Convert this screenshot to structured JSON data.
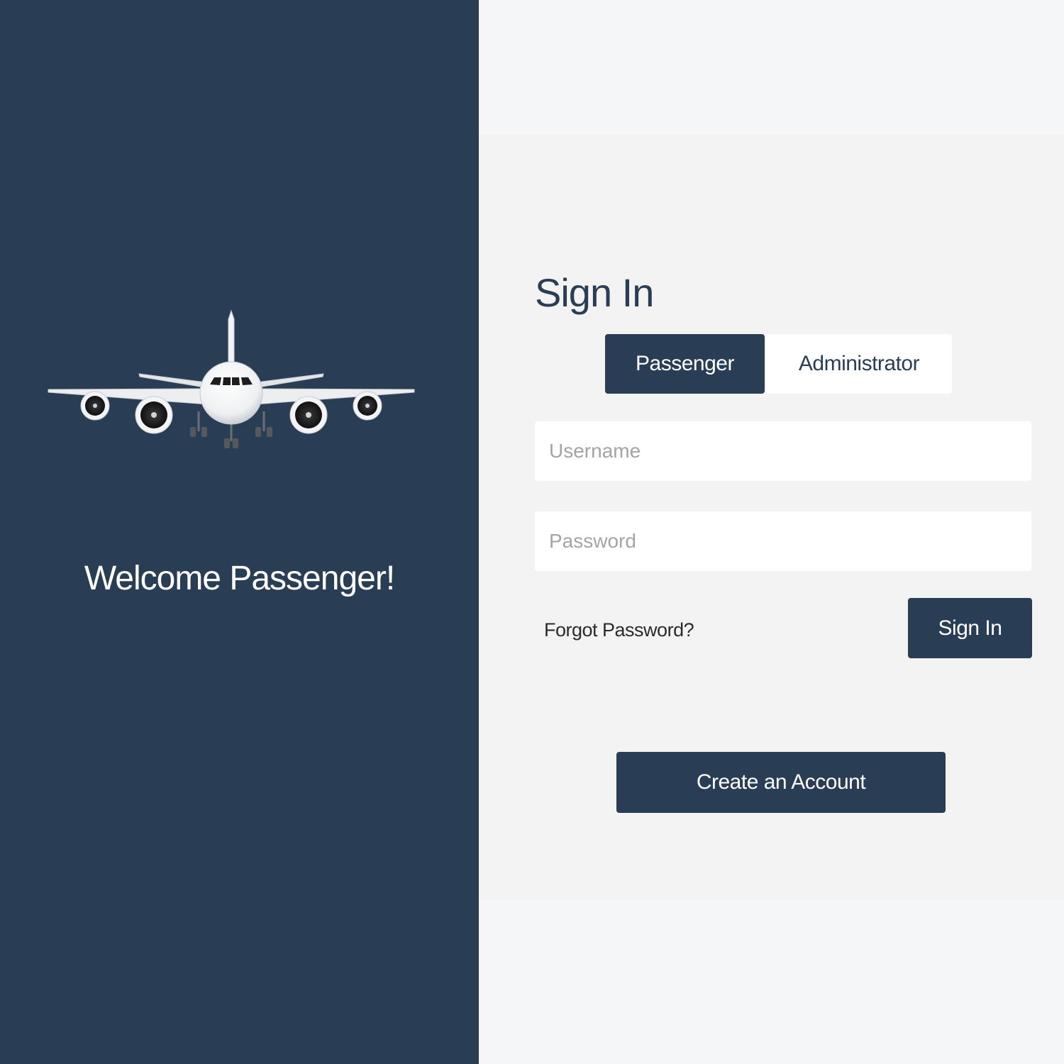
{
  "welcome": {
    "message": "Welcome Passenger!",
    "illustration": "airplane-illustration"
  },
  "signin": {
    "title": "Sign In",
    "tabs": [
      {
        "label": "Passenger",
        "active": true
      },
      {
        "label": "Administrator",
        "active": false
      }
    ],
    "username": {
      "placeholder": "Username",
      "value": ""
    },
    "password": {
      "placeholder": "Password",
      "value": ""
    },
    "forgot_label": "Forgot Password?",
    "submit_label": "Sign In",
    "create_account_label": "Create an Account"
  },
  "colors": {
    "primary": "#293e55",
    "background": "#f5f6f7",
    "card": "#f3f3f3",
    "field": "#ffffff",
    "placeholder": "#a4a4a4"
  }
}
